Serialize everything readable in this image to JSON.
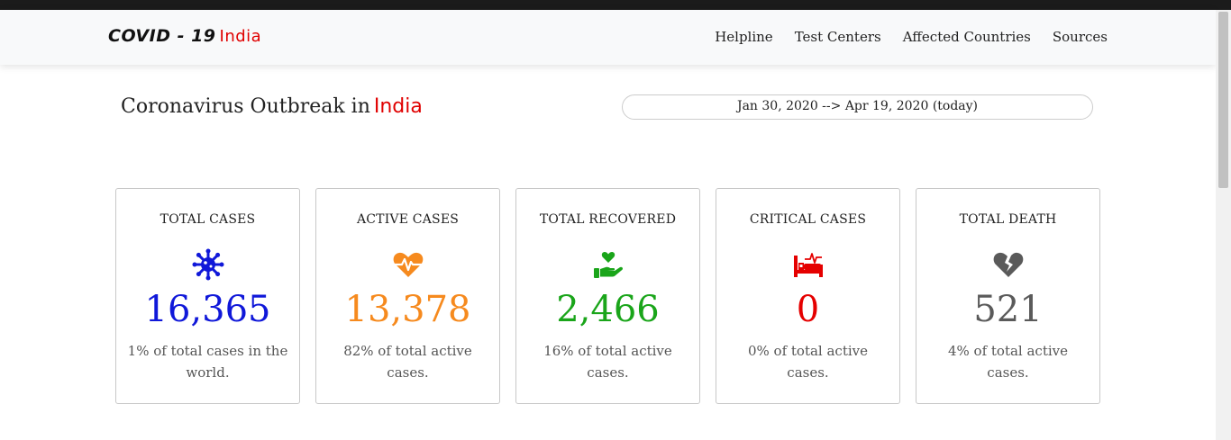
{
  "brand": {
    "name": "COVID - 19",
    "country": "India"
  },
  "nav": {
    "items": [
      "Helpline",
      "Test Centers",
      "Affected Countries",
      "Sources"
    ]
  },
  "header": {
    "title": "Coronavirus Outbreak in",
    "country": "India"
  },
  "date_range": "Jan 30, 2020 --> Apr 19, 2020 (today)",
  "colors": {
    "accent_red": "#e00000",
    "total_cases": "#1018d9",
    "active_cases": "#f68a1e",
    "recovered": "#1aa51a",
    "critical": "#e50000",
    "death": "#5a5a5a"
  },
  "cards": [
    {
      "label": "TOTAL CASES",
      "icon": "virus-icon",
      "value": "16,365",
      "desc": "1% of total cases in the world."
    },
    {
      "label": "ACTIVE CASES",
      "icon": "heartbeat-icon",
      "value": "13,378",
      "desc": "82% of total active cases."
    },
    {
      "label": "TOTAL RECOVERED",
      "icon": "hand-holding-heart-icon",
      "value": "2,466",
      "desc": "16% of total active cases."
    },
    {
      "label": "CRITICAL CASES",
      "icon": "hospital-bed-icon",
      "value": "0",
      "desc": "0% of total active cases."
    },
    {
      "label": "TOTAL DEATH",
      "icon": "broken-heart-icon",
      "value": "521",
      "desc": "4% of total active cases."
    }
  ]
}
